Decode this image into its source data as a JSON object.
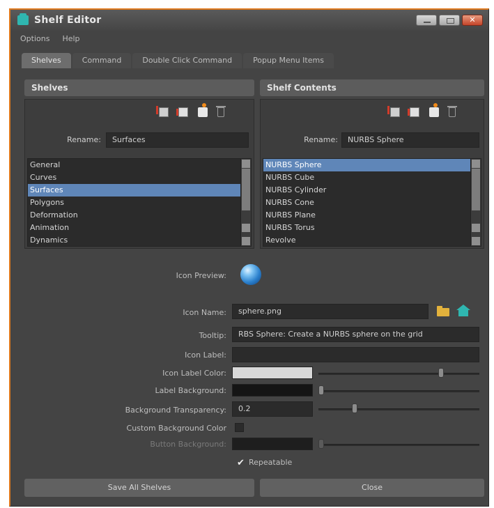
{
  "window": {
    "title": "Shelf Editor"
  },
  "menu": [
    "Options",
    "Help"
  ],
  "tabs": [
    {
      "label": "Shelves",
      "active": true
    },
    {
      "label": "Command",
      "active": false
    },
    {
      "label": "Double Click Command",
      "active": false
    },
    {
      "label": "Popup Menu Items",
      "active": false
    }
  ],
  "shelves": {
    "header": "Shelves",
    "rename_label": "Rename:",
    "rename_value": "Surfaces",
    "items": [
      "General",
      "Curves",
      "Surfaces",
      "Polygons",
      "Deformation",
      "Animation",
      "Dynamics"
    ],
    "selected_index": 2
  },
  "contents": {
    "header": "Shelf Contents",
    "rename_label": "Rename:",
    "rename_value": "NURBS Sphere",
    "items": [
      "NURBS Sphere",
      "NURBS Cube",
      "NURBS Cylinder",
      "NURBS Cone",
      "NURBS Plane",
      "NURBS Torus",
      "Revolve"
    ],
    "selected_index": 0
  },
  "toolbar_icons": [
    "new-shelf-icon",
    "load-shelf-icon",
    "save-shelf-icon",
    "delete-icon"
  ],
  "fields": {
    "icon_preview_label": "Icon Preview:",
    "icon_name_label": "Icon Name:",
    "icon_name_value": "sphere.png",
    "tooltip_label": "Tooltip:",
    "tooltip_value": "RBS Sphere: Create a NURBS sphere on the grid",
    "icon_label_label": "Icon Label:",
    "icon_label_value": "",
    "icon_label_color_label": "Icon Label Color:",
    "icon_label_color": "#d8d8d8",
    "icon_label_color_slider": 0.8,
    "label_background_label": "Label Background:",
    "label_background_color": "#151515",
    "label_background_slider": 0.02,
    "bg_transparency_label": "Background Transparency:",
    "bg_transparency_value": "0.2",
    "bg_transparency_slider": 0.2,
    "custom_bg_color_label": "Custom Background Color",
    "button_bg_label": "Button Background:",
    "button_bg_color": "#1e1e1e",
    "button_bg_slider": 0.02,
    "repeatable_label": "Repeatable",
    "repeatable_checked": true
  },
  "buttons": {
    "save_all": "Save All Shelves",
    "close": "Close"
  },
  "colors": {
    "accent": "#e07a1e",
    "selection": "#5f86b8",
    "window_bg": "#444444"
  }
}
